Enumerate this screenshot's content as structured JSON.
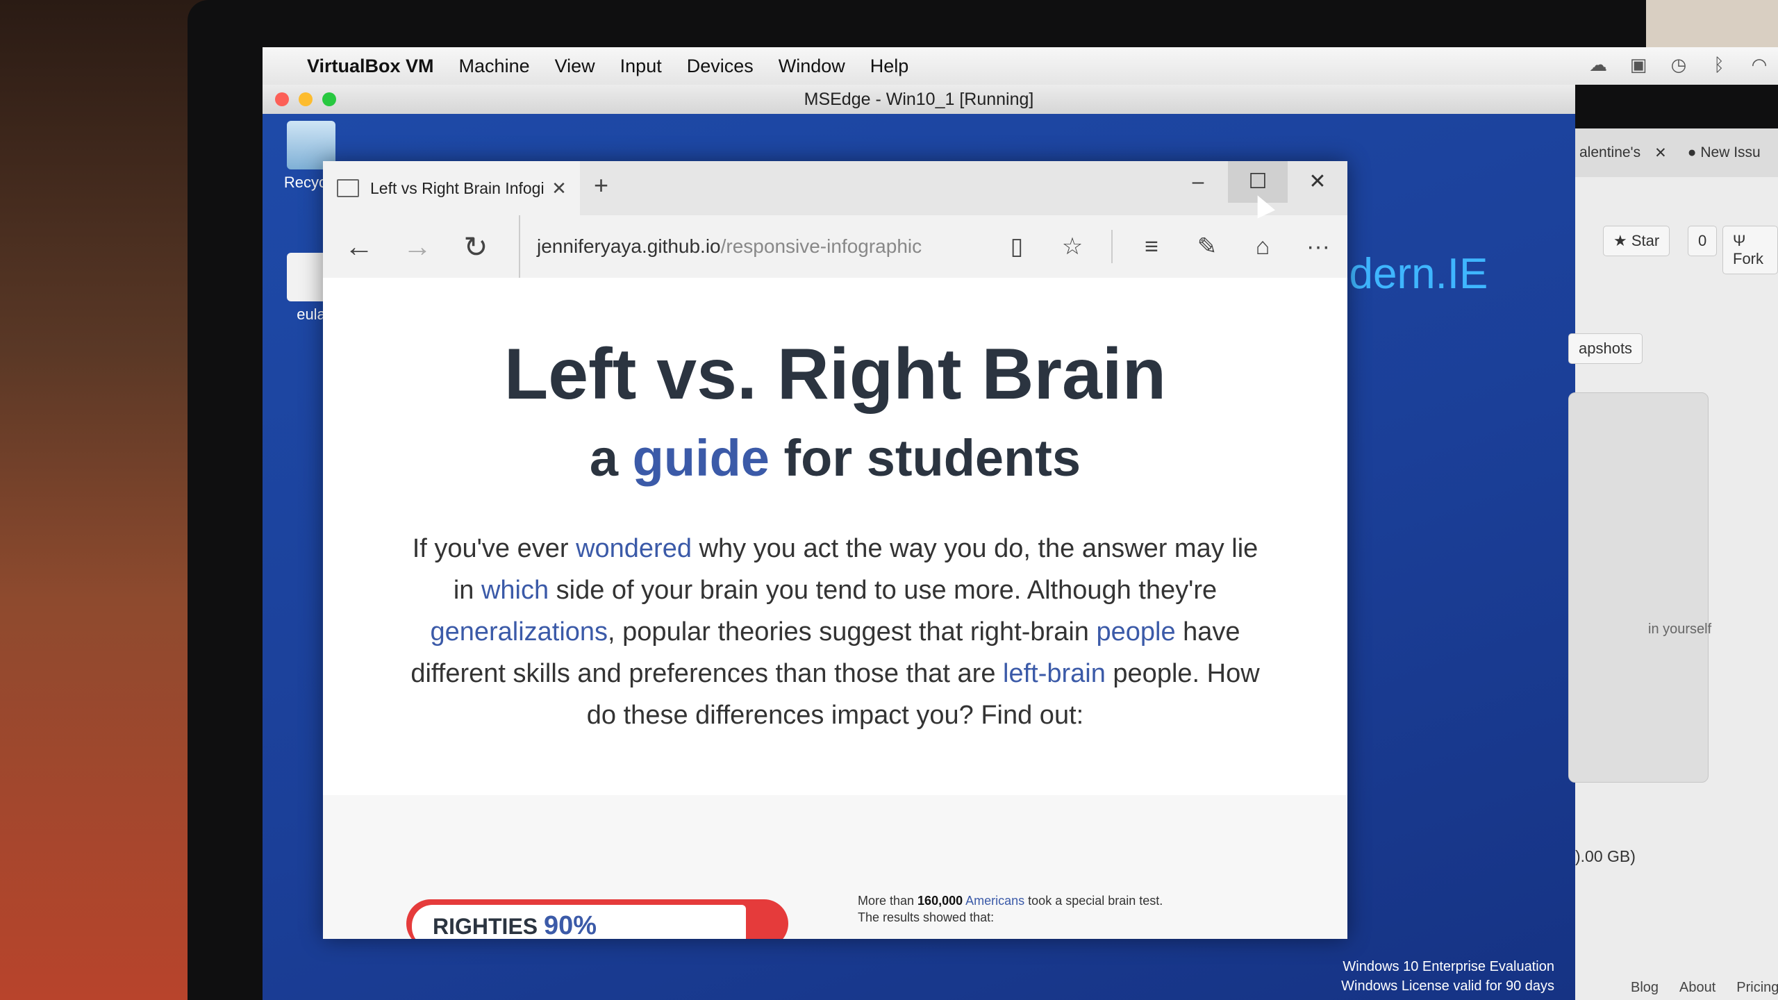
{
  "mac_menu": {
    "app_name": "VirtualBox VM",
    "items": [
      "Machine",
      "View",
      "Input",
      "Devices",
      "Window",
      "Help"
    ]
  },
  "vm_window": {
    "title": "MSEdge - Win10_1 [Running]"
  },
  "desktop": {
    "icons": [
      "Recycle",
      "eula"
    ],
    "brand_text": "odern.IE",
    "eval_line1": "Windows 10 Enterprise Evaluation",
    "eval_line2": "Windows License valid for 90 days"
  },
  "host_app": {
    "tab_label": "alentine's",
    "new_issue": "New Issu",
    "star_label": "Star",
    "star_count": "0",
    "fork_label": "Fork",
    "snapshots": "apshots",
    "yourself": "in yourself",
    "size": ").00 GB)",
    "footer_links": [
      "Blog",
      "About",
      "Pricing"
    ]
  },
  "browser": {
    "tab_title": "Left vs Right Brain Infogi",
    "url_domain": "jenniferyaya.github.io",
    "url_path": "/responsive-infographic"
  },
  "page": {
    "title": "Left vs. Right Brain",
    "subtitle_a": "a ",
    "subtitle_guide": "guide",
    "subtitle_b": " for students",
    "intro_1": "If you've ever ",
    "intro_hl1": "wondered",
    "intro_2": " why you act the way you do, the answer may lie in ",
    "intro_hl2": "which",
    "intro_3": " side of your brain you tend to use more. Although they're ",
    "intro_hl3": "generalizations",
    "intro_4": ", popular theories suggest that right-brain ",
    "intro_hl4": "people",
    "intro_5": " have different skills and preferences than those that are ",
    "intro_hl5": "left-brain",
    "intro_6": " people. How do these differences impact you? Find out:",
    "bar_label": "RIGHTIES ",
    "bar_percent": "90%",
    "bar_fraction": 0.9,
    "stat_1": "More than ",
    "stat_num": "160,000",
    "stat_2": " ",
    "stat_hl": "Americans",
    "stat_3": " took a special brain test.",
    "stat_line2": "The results showed that:"
  },
  "colors": {
    "accent_blue": "#3b5aa8",
    "bar_red": "#e53b3b",
    "desktop_blue": "#1b3f98"
  }
}
